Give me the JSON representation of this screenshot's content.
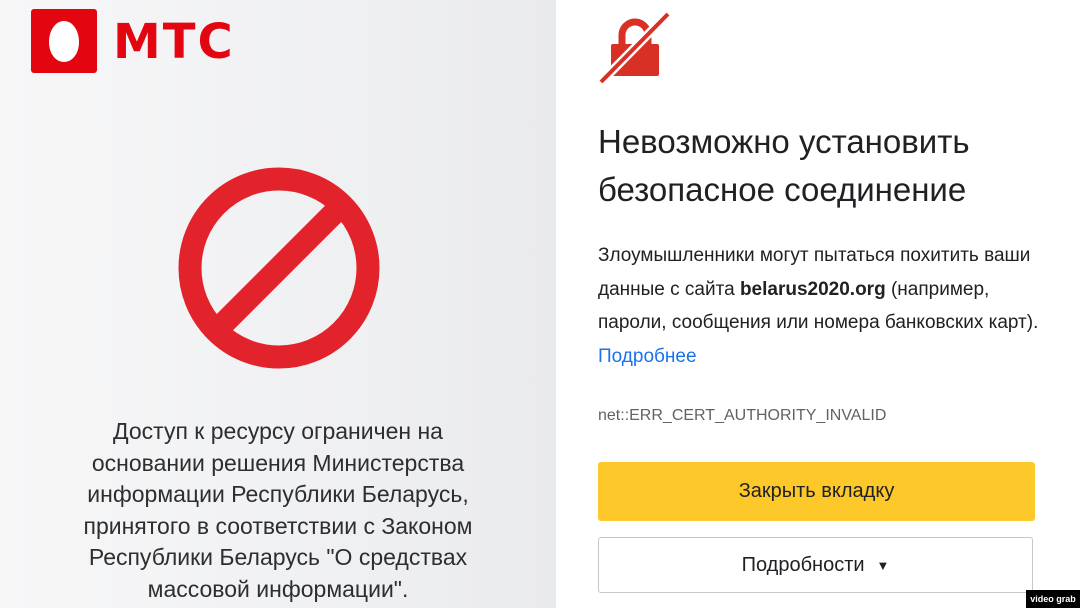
{
  "left": {
    "logo_text": "МТС",
    "block_message": "Доступ к ресурсу ограничен на основании решения Министерства информации Республики Беларусь, принятого в соответствии с Законом Республики Беларусь \"О средствах массовой информации\"."
  },
  "right": {
    "title": "Невозможно установить безопасное соединение",
    "body_part1": "Злоумышленники могут пытаться похитить ваши данные с сайта ",
    "site": "belarus2020.org",
    "body_part2": " (например, пароли, сообщения или номера банковских карт). ",
    "learn_more": "Подробнее",
    "error_code": "net::ERR_CERT_AUTHORITY_INVALID",
    "close_tab_label": "Закрыть вкладку",
    "details_label": "Подробности",
    "details_caret": "▼"
  },
  "watermark": "video grab",
  "colors": {
    "mts_red": "#e30611",
    "prohibited_red": "#e2232b",
    "button_yellow": "#fdc82a",
    "link_blue": "#1a73e8"
  },
  "icons": {
    "logo": "mts-egg-logo-icon",
    "blocked": "prohibited-sign-icon",
    "insecure": "broken-lock-icon"
  }
}
